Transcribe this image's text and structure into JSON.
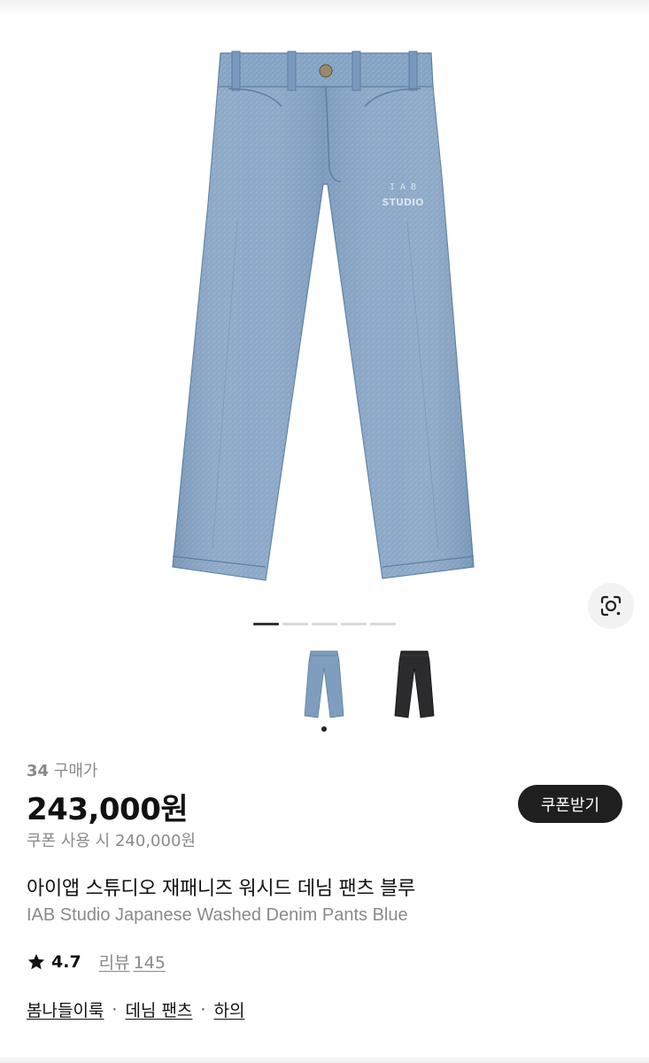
{
  "product": {
    "purchase_count": "34",
    "purchase_label": "구매가",
    "price": "243,000원",
    "coupon_button": "쿠폰받기",
    "coupon_price": "쿠폰 사용 시 240,000원",
    "title_ko": "아이앱 스튜디오 재패니즈 워시드 데님 팬츠 블루",
    "title_en": "IAB Studio Japanese Washed Denim Pants Blue",
    "rating": "4.7",
    "review_label": "리뷰",
    "review_count": "145",
    "image_logo_text": [
      "I A B",
      "STUDIO"
    ]
  },
  "gallery": {
    "page_count": 5,
    "active_page": 1,
    "variants": [
      {
        "name": "blue",
        "color": "#7f9dbd",
        "selected": true
      },
      {
        "name": "black",
        "color": "#2b2b2d",
        "selected": false
      }
    ]
  },
  "breadcrumb": {
    "items": [
      "봄나들이룩",
      "데님 팬츠",
      "하의"
    ],
    "separator": "·"
  },
  "colors": {
    "denim": "#87a5c6",
    "denim_dark": "#6f8fb2",
    "button_bg": "#1f1f1f",
    "muted_text": "#8a8a8a"
  },
  "icons": {
    "lens": "lens-search-icon",
    "star": "star-icon"
  }
}
